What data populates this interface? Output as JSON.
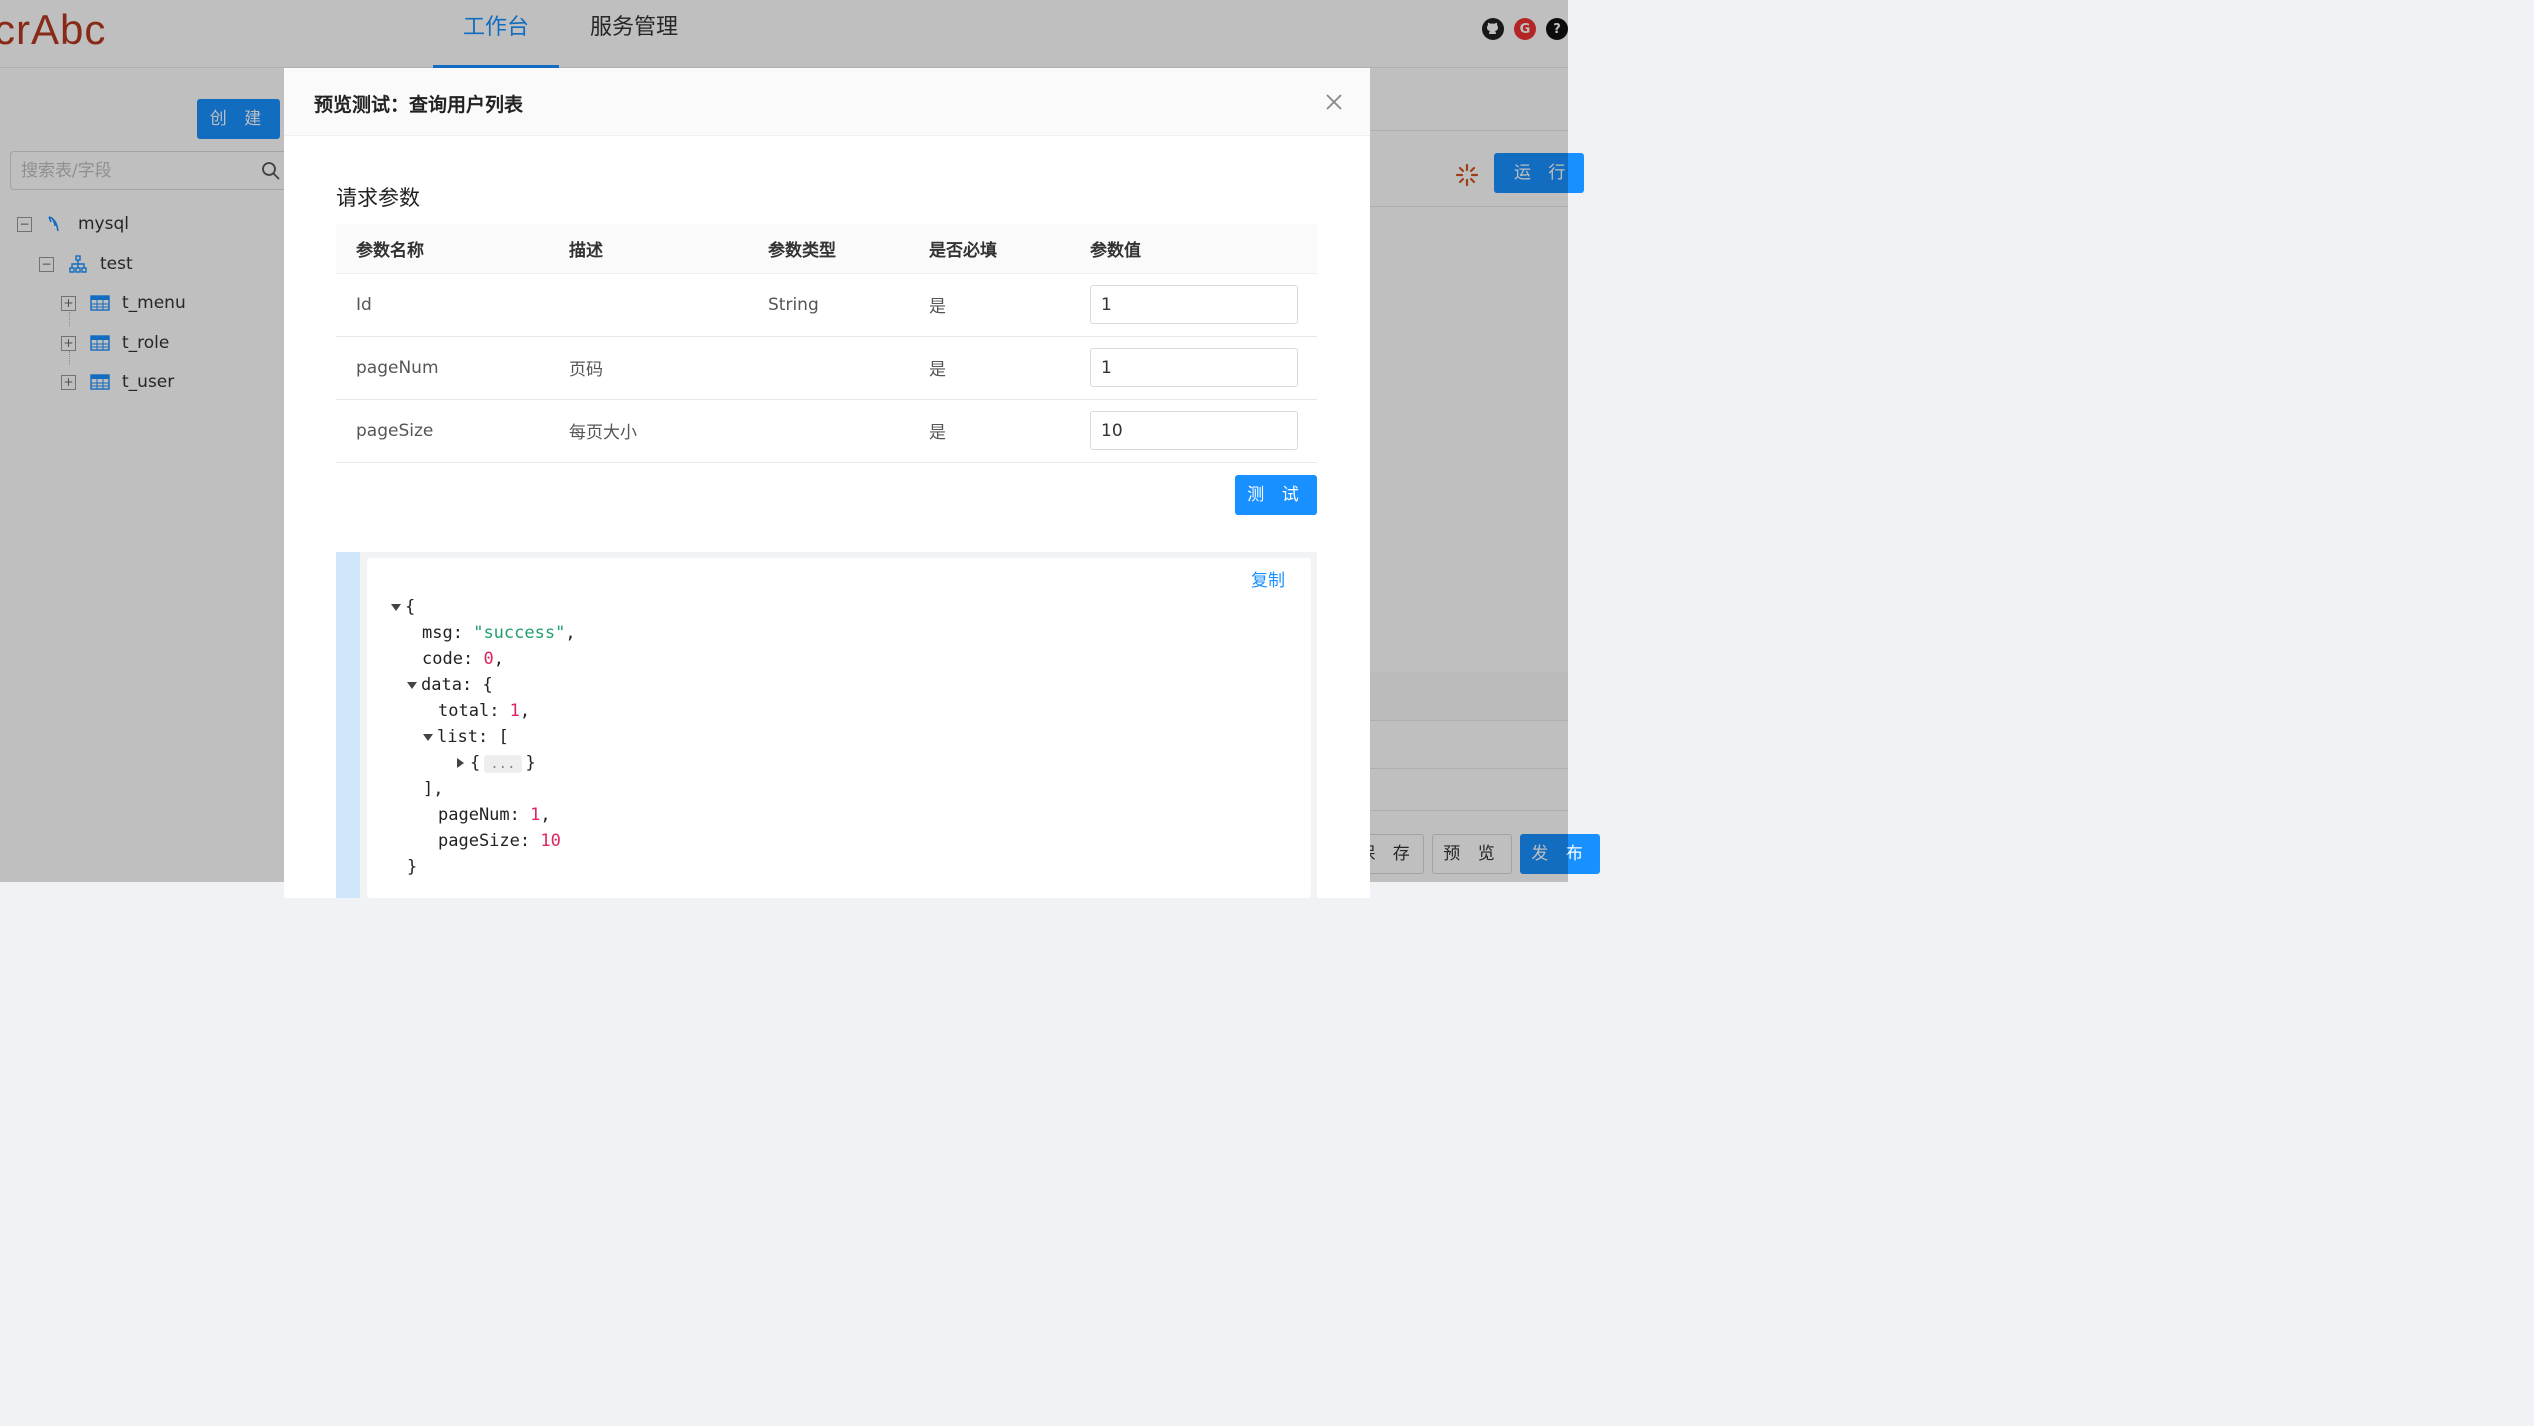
{
  "app": {
    "logo_text": "crAbc",
    "nav": [
      {
        "label": "工作台",
        "active": true
      },
      {
        "label": "服务管理",
        "active": false
      }
    ],
    "header_icons": [
      "github-icon",
      "g-icon",
      "help-icon"
    ]
  },
  "sidebar": {
    "create_label": "创 建",
    "search_placeholder": "搜索表/字段",
    "tree": [
      {
        "label": "mysql",
        "icon": "database-icon",
        "level": 0,
        "expanded": true
      },
      {
        "label": "test",
        "icon": "schema-icon",
        "level": 1,
        "expanded": true
      },
      {
        "label": "t_menu",
        "icon": "table-icon",
        "level": 2,
        "expanded": false
      },
      {
        "label": "t_role",
        "icon": "table-icon",
        "level": 2,
        "expanded": false
      },
      {
        "label": "t_user",
        "icon": "table-icon",
        "level": 2,
        "expanded": false
      }
    ]
  },
  "toolbar": {
    "run_label": "运 行",
    "save_label": "保 存",
    "preview_label": "预 览",
    "publish_label": "发 布"
  },
  "modal": {
    "title": "预览测试：查询用户列表",
    "section_title": "请求参数",
    "columns": [
      "参数名称",
      "描述",
      "参数类型",
      "是否必填",
      "参数值"
    ],
    "rows": [
      {
        "name": "Id",
        "desc": "",
        "type": "String",
        "required": "是",
        "value": "1"
      },
      {
        "name": "pageNum",
        "desc": "页码",
        "type": "",
        "required": "是",
        "value": "1"
      },
      {
        "name": "pageSize",
        "desc": "每页大小",
        "type": "",
        "required": "是",
        "value": "10"
      }
    ],
    "test_label": "测 试",
    "copy_label": "复制"
  },
  "result": {
    "lines": [
      {
        "k": "",
        "text": "{"
      },
      {
        "k": "msg",
        "val": "\"success\"",
        "kind": "string"
      },
      {
        "k": "code",
        "val": "0",
        "kind": "number"
      },
      {
        "k": "data",
        "text": "{"
      },
      {
        "k": "total",
        "val": "1",
        "kind": "number"
      },
      {
        "k": "list",
        "text": "["
      },
      {
        "k": "",
        "text": "{"
      },
      {
        "k": "",
        "text": "],"
      },
      {
        "k": "pageNum",
        "val": "1",
        "kind": "number"
      },
      {
        "k": "pageSize",
        "val": "10",
        "kind": "number"
      },
      {
        "k": "",
        "text": "}"
      }
    ],
    "collapsed_ellipsis": "...",
    "close_brace": "}"
  },
  "colors": {
    "primary": "#1890ff",
    "logo": "#b5391f",
    "json_string": "#22a06b",
    "json_number": "#e0245e"
  }
}
